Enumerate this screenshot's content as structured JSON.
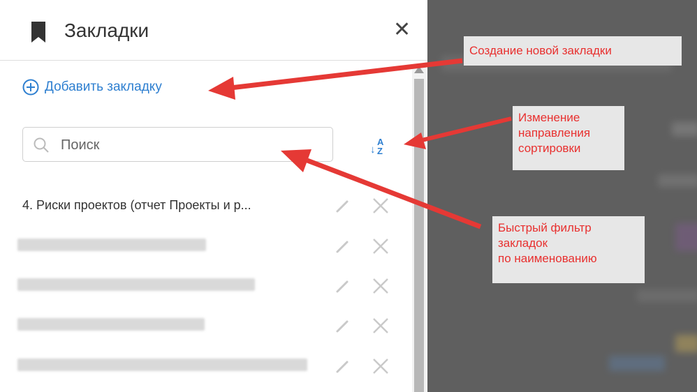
{
  "panel": {
    "title": "Закладки",
    "add_label": "Добавить закладку",
    "search": {
      "placeholder": "Поиск",
      "value": ""
    },
    "sort_top": "A",
    "sort_bottom": "Z",
    "items": [
      {
        "label": "4. Риски проектов (отчет Проекты и р..."
      }
    ]
  },
  "callouts": {
    "new_bookmark": "Создание новой закладки",
    "sort_line1": "Изменение",
    "sort_line2": "направления",
    "sort_line3": "сортировки",
    "filter_line1": "Быстрый фильтр",
    "filter_line2": "закладок",
    "filter_line3": "по наименованию"
  },
  "colors": {
    "accent": "#2e7fd0",
    "callout_text": "#e8302f",
    "arrow": "#e53935",
    "backdrop": "#5f5f5f"
  },
  "icons": [
    "bookmark-icon",
    "close-icon",
    "plus-circle-icon",
    "search-icon",
    "sort-az-icon",
    "pencil-icon",
    "delete-x-icon"
  ]
}
